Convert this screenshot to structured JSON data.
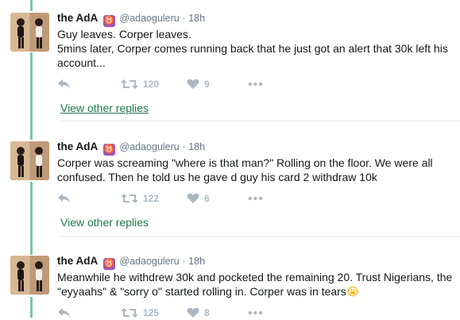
{
  "thread": {
    "tweets": [
      {
        "display_name": "the AdA",
        "zodiac": "♉",
        "handle": "@adaoguleru",
        "separator": "·",
        "time": "18h",
        "text": "Guy leaves. Corper leaves.\n5mins later, Corper comes running back that he just got an alert that 30k left his account...",
        "retweets": "120",
        "likes": "9",
        "more": "•••",
        "view_replies": "View other replies"
      },
      {
        "display_name": "the AdA",
        "zodiac": "♉",
        "handle": "@adaoguleru",
        "separator": "·",
        "time": "18h",
        "text": "Corper was screaming \"where is that man?\" Rolling on the floor. We were all confused. Then he told us he gave d guy his card 2 withdraw 10k",
        "retweets": "122",
        "likes": "6",
        "more": "•••",
        "view_replies": "View other replies"
      },
      {
        "display_name": "the AdA",
        "zodiac": "♉",
        "handle": "@adaoguleru",
        "separator": "·",
        "time": "18h",
        "text": "Meanwhile he withdrew 30k and pocketed the remaining 20. Trust Nigerians, the \"eyyaahs\" & \"sorry o\" started rolling in. Corper was in tears",
        "emoji": "😭",
        "retweets": "125",
        "likes": "8",
        "more": "•••"
      }
    ]
  },
  "colors": {
    "thread_line": "#7bc7a1",
    "link": "#1b7a4c",
    "muted": "#657786",
    "icon": "#aab8c2"
  }
}
